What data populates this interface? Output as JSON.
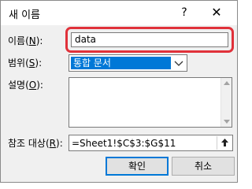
{
  "window": {
    "title": "새 이름",
    "help_glyph": "?",
    "close_glyph": "✕"
  },
  "fields": {
    "name": {
      "label_text": "이름(",
      "label_key": "N",
      "label_end": "):",
      "value": "data"
    },
    "scope": {
      "label_text": "범위(",
      "label_key": "S",
      "label_end": "):",
      "value": "통합 문서"
    },
    "comment": {
      "label_text": "설명(",
      "label_key": "O",
      "label_end": "):",
      "value": ""
    },
    "refers_to": {
      "label_text": "참조 대상(",
      "label_key": "R",
      "label_end": "):",
      "value": "=Sheet1!$C$3:$G$11"
    }
  },
  "buttons": {
    "ok_label": "확인",
    "cancel_label": "취소"
  },
  "colors": {
    "highlight": "#e0313a",
    "selection": "#0078d7"
  }
}
